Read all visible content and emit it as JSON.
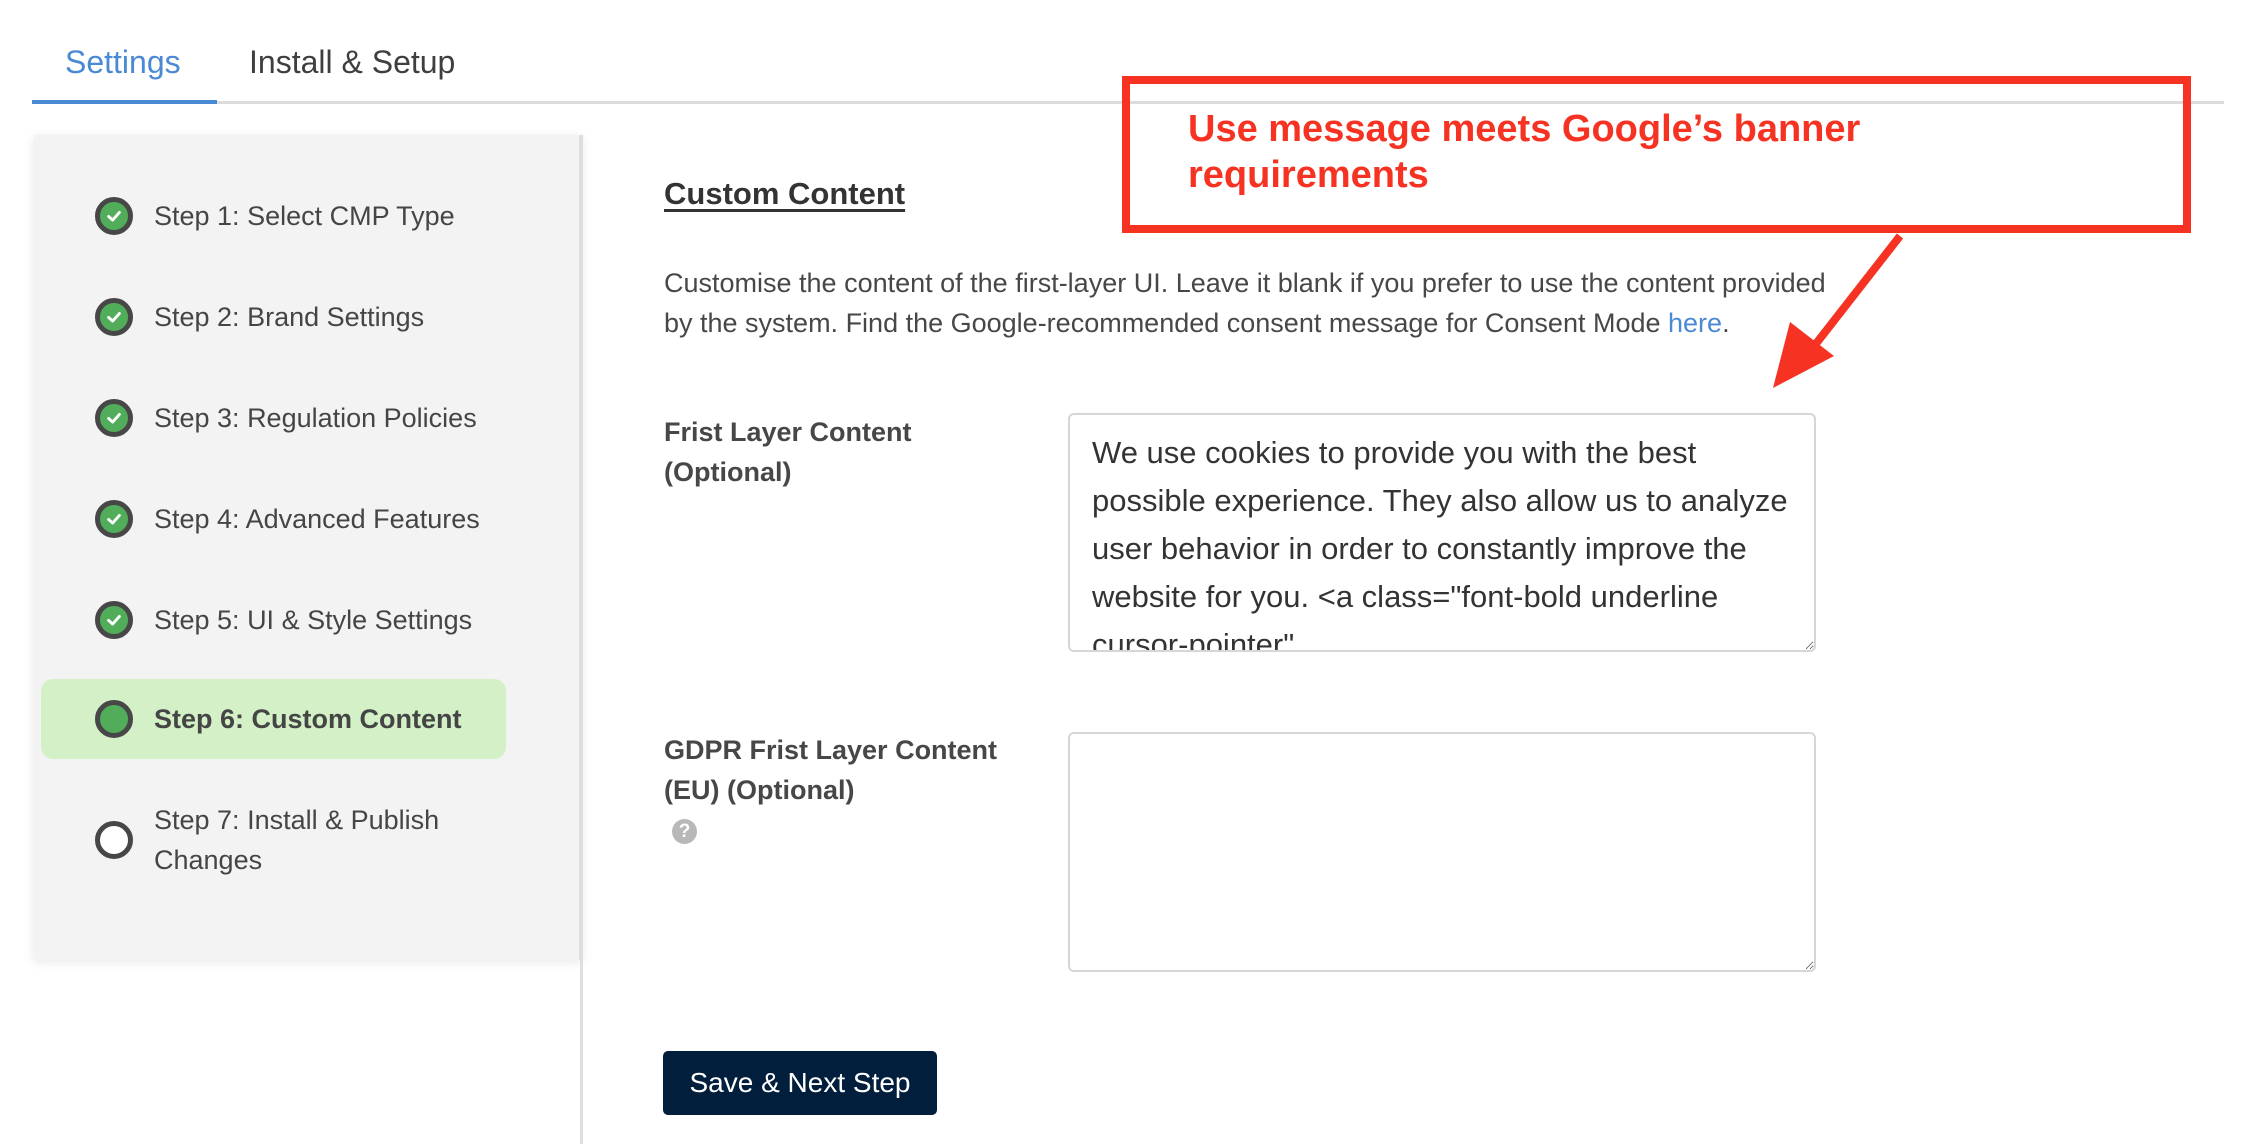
{
  "tabs": [
    {
      "label": "Settings",
      "active": true
    },
    {
      "label": "Install & Setup",
      "active": false
    }
  ],
  "sidebar": {
    "steps": [
      {
        "label": "Step 1: Select CMP Type",
        "status": "completed"
      },
      {
        "label": "Step 2: Brand Settings",
        "status": "completed"
      },
      {
        "label": "Step 3: Regulation Policies",
        "status": "completed"
      },
      {
        "label": "Step 4: Advanced Features",
        "status": "completed"
      },
      {
        "label": "Step 5: UI & Style Settings",
        "status": "completed"
      },
      {
        "label": "Step 6: Custom Content",
        "status": "current"
      },
      {
        "label": "Step 7: Install & Publish Changes",
        "status": "pending"
      }
    ]
  },
  "main": {
    "title": "Custom Content",
    "description_before_link": "Customise the content of the first-layer UI. Leave it blank if you prefer to use the content provided by the system. Find the Google-recommended consent message for Consent Mode ",
    "description_link": "here",
    "description_after_link": ".",
    "fields": [
      {
        "label": "Frist Layer Content (Optional)",
        "value": "We use cookies to provide you with the best possible experience. They also allow us to analyze user behavior in order to constantly improve the website for you. <a class=\"font-bold underline cursor-pointer\"",
        "help_icon": false
      },
      {
        "label": "GDPR Frist Layer Content (EU) (Optional)",
        "value": "",
        "help_icon": true,
        "help_icon_glyph": "?"
      }
    ],
    "save_button": "Save & Next Step"
  },
  "annotation": {
    "text": "Use message meets Google’s banner requirements",
    "color": "#f63323"
  },
  "colors": {
    "accent": "#4a8ad4",
    "step_complete": "#52ad5b",
    "step_active_bg": "#d3f0c6",
    "button_bg": "#021e3d"
  }
}
